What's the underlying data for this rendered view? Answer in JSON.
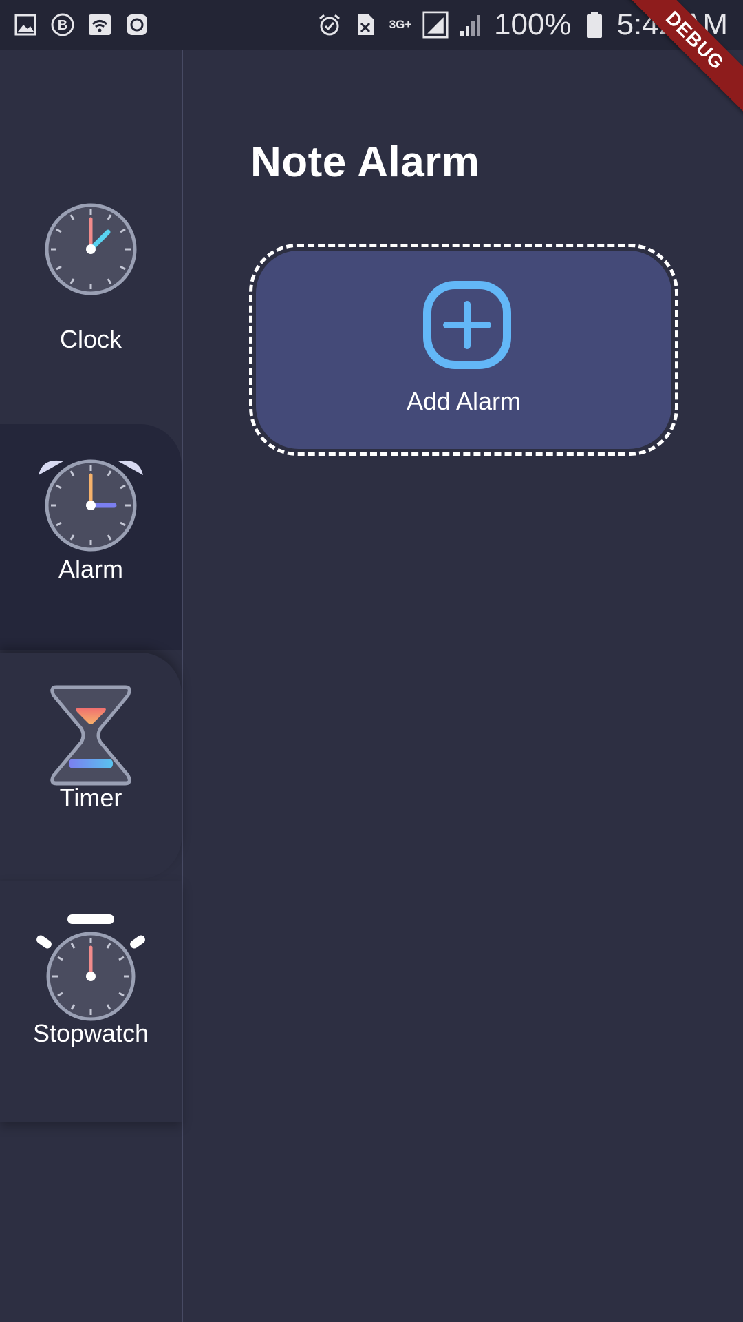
{
  "status_bar": {
    "left_icons": [
      "image-icon",
      "b-badge-icon",
      "wifi-icon",
      "app-icon"
    ],
    "right_icons": [
      "alarm-status-icon",
      "sim-icon",
      "signal-icon",
      "signal-icon-2",
      "battery-icon"
    ],
    "network_type": "3G+",
    "battery": "100%",
    "time": "5:42 AM"
  },
  "debug_banner": "DEBUG",
  "sidebar": {
    "items": [
      {
        "label": "Clock",
        "icon": "clock-icon",
        "selected": false
      },
      {
        "label": "Alarm",
        "icon": "alarm-clock-icon",
        "selected": true
      },
      {
        "label": "Timer",
        "icon": "hourglass-icon",
        "selected": false
      },
      {
        "label": "Stopwatch",
        "icon": "stopwatch-icon",
        "selected": false
      }
    ]
  },
  "main": {
    "title": "Note Alarm",
    "add_button": {
      "label": "Add Alarm",
      "icon": "plus-square-icon"
    }
  },
  "colors": {
    "background": "#2d2f42",
    "sidebar_selected": "#24263a",
    "card": "#444a78",
    "accent_blue": "#63b7f7",
    "debug_red": "#8e1c1c"
  }
}
